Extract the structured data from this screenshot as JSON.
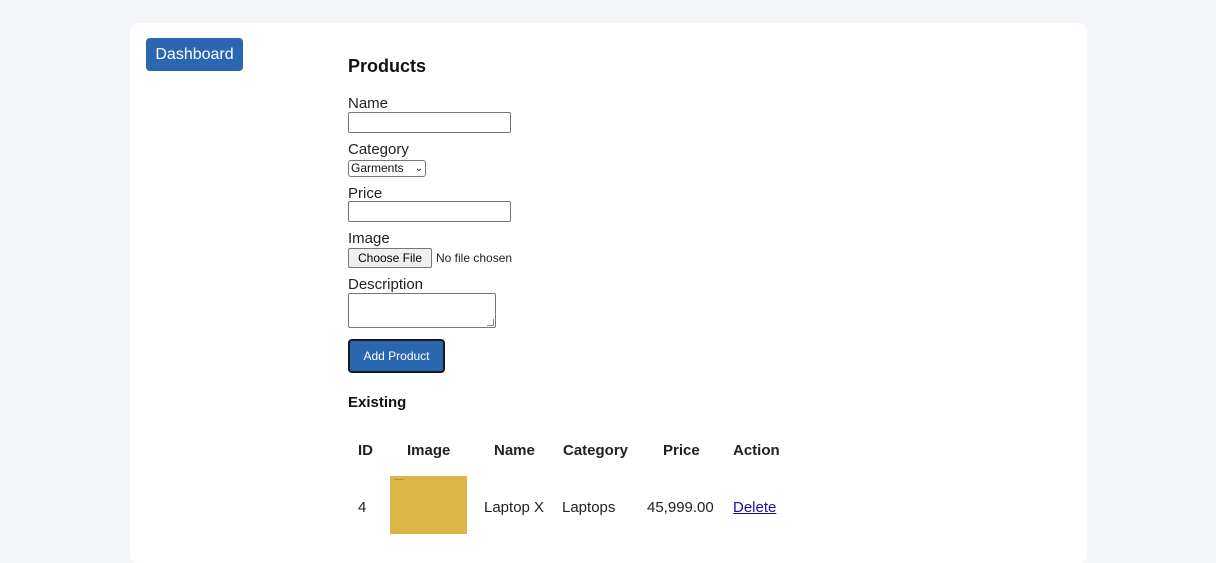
{
  "sidebar": {
    "dashboard_label": "Dashboard"
  },
  "form": {
    "title": "Products",
    "name_label": "Name",
    "name_value": "",
    "category_label": "Category",
    "category_selected": "Garments",
    "price_label": "Price",
    "price_value": "",
    "image_label": "Image",
    "choose_file_label": "Choose File",
    "file_status": "No file chosen",
    "description_label": "Description",
    "description_value": "",
    "submit_label": "Add Product"
  },
  "existing": {
    "title": "Existing",
    "columns": [
      "ID",
      "Image",
      "Name",
      "Category",
      "Price",
      "Action"
    ],
    "rows": [
      {
        "id": "4",
        "image_color": "#dcb547",
        "name": "Laptop X",
        "category": "Laptops",
        "price": "45,999.00",
        "action": "Delete"
      }
    ]
  },
  "colors": {
    "accent": "#2b67b1",
    "page_bg": "#f3f5f9",
    "link": "#1a0dab"
  }
}
